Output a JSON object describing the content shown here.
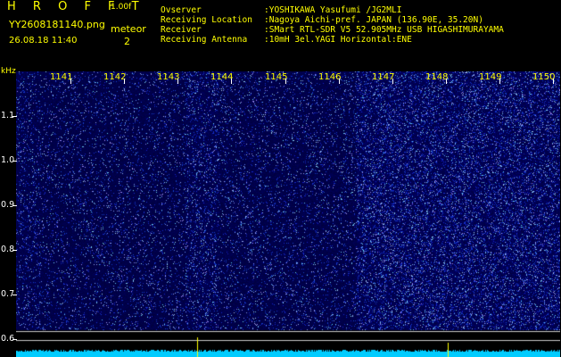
{
  "header": {
    "logo": "H R O F F T",
    "version": "1.00f",
    "filename": "YY2608181140.png",
    "datetime": "26.08.18 11:40",
    "meteor_label": "meteor",
    "meteor_count": "2"
  },
  "info": {
    "observer_label": "Ovserver",
    "observer_value": ":YOSHIKAWA Yasufumi /JG2MLI",
    "location_label": "Receiving Location",
    "location_value": ":Nagoya Aichi-pref. JAPAN (136.90E, 35.20N)",
    "receiver_label": "Receiver",
    "receiver_value": ":SMart RTL-SDR V5 52.905MHz USB HIGASHIMURAYAMA",
    "antenna_label": "Receiving Antenna",
    "antenna_value": ":10mH 3el.YAGI Horizontal:ENE"
  },
  "axes": {
    "y_unit": "kHz",
    "y_ticks": [
      "1.1",
      "1.0",
      "0.9",
      "0.8",
      "0.7",
      "0.6"
    ],
    "x_ticks": [
      "1141",
      "1142",
      "1143",
      "1144",
      "1145",
      "1146",
      "1147",
      "1148",
      "1149",
      "1150"
    ]
  },
  "colors": {
    "label_yellow": "#ffff00",
    "spectrogram_base": "#00007a",
    "noise_floor": "#00ccff"
  }
}
